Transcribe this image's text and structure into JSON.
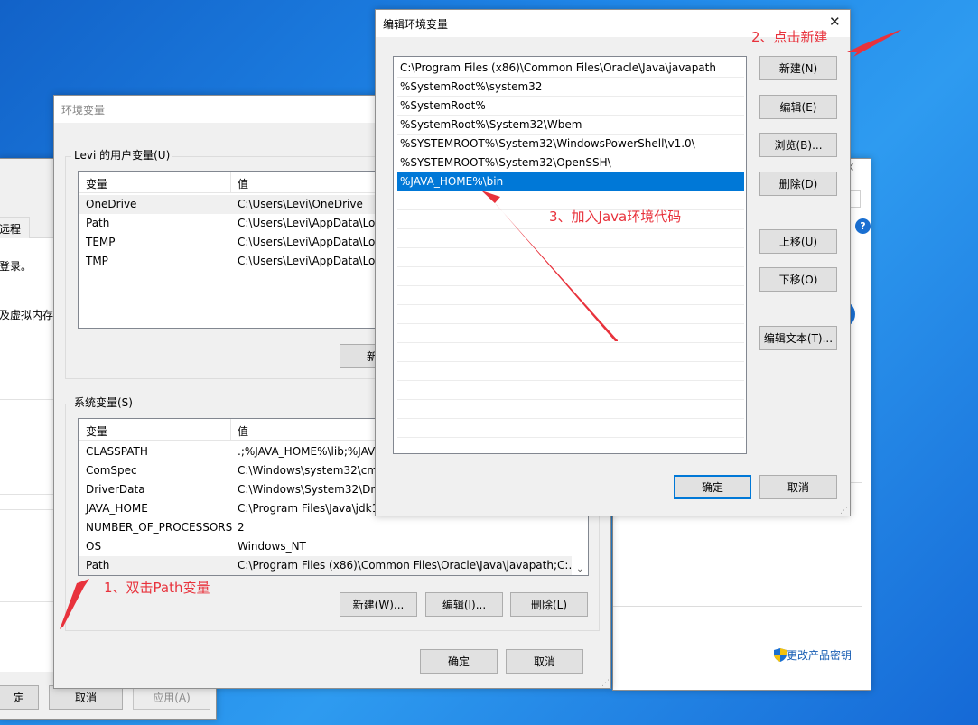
{
  "sysprops": {
    "tab_fragment": "远程",
    "text1": "登录。",
    "text2": "及虚拟内存",
    "ok_fragment": "定",
    "cancel": "取消",
    "apply": "应用(A)"
  },
  "about": {
    "change_key": "更改产品密钥"
  },
  "envvars": {
    "title": "环境变量",
    "user_group": "Levi 的用户变量(U)",
    "col_var": "变量",
    "col_val": "值",
    "user_rows": [
      {
        "var": "OneDrive",
        "val": "C:\\Users\\Levi\\OneDrive"
      },
      {
        "var": "Path",
        "val": "C:\\Users\\Levi\\AppData\\Loc"
      },
      {
        "var": "TEMP",
        "val": "C:\\Users\\Levi\\AppData\\Loc"
      },
      {
        "var": "TMP",
        "val": "C:\\Users\\Levi\\AppData\\Loc"
      }
    ],
    "user_new": "新建",
    "sys_group": "系统变量(S)",
    "sys_rows": [
      {
        "var": "CLASSPATH",
        "val": ".;%JAVA_HOME%\\lib;%JAV"
      },
      {
        "var": "ComSpec",
        "val": "C:\\Windows\\system32\\cmd"
      },
      {
        "var": "DriverData",
        "val": "C:\\Windows\\System32\\Driv"
      },
      {
        "var": "JAVA_HOME",
        "val": "C:\\Program Files\\Java\\jdk1"
      },
      {
        "var": "NUMBER_OF_PROCESSORS",
        "val": "2"
      },
      {
        "var": "OS",
        "val": "Windows_NT"
      },
      {
        "var": "Path",
        "val": "C:\\Program Files (x86)\\Common Files\\Oracle\\Java\\javapath;C:..."
      }
    ],
    "sys_new": "新建(W)...",
    "sys_edit": "编辑(I)...",
    "sys_delete": "删除(L)",
    "ok": "确定",
    "cancel": "取消"
  },
  "editor": {
    "title": "编辑环境变量",
    "items": [
      "C:\\Program Files (x86)\\Common Files\\Oracle\\Java\\javapath",
      "%SystemRoot%\\system32",
      "%SystemRoot%",
      "%SystemRoot%\\System32\\Wbem",
      "%SYSTEMROOT%\\System32\\WindowsPowerShell\\v1.0\\",
      "%SYSTEMROOT%\\System32\\OpenSSH\\",
      "%JAVA_HOME%\\bin"
    ],
    "btn_new": "新建(N)",
    "btn_edit": "编辑(E)",
    "btn_browse": "浏览(B)...",
    "btn_delete": "删除(D)",
    "btn_up": "上移(U)",
    "btn_down": "下移(O)",
    "btn_edit_text": "编辑文本(T)...",
    "ok": "确定",
    "cancel": "取消"
  },
  "annotations": {
    "a1": "1、双击Path变量",
    "a2": "2、点击新建",
    "a3": "3、加入Java环境代码",
    "color": "#e8323c"
  }
}
